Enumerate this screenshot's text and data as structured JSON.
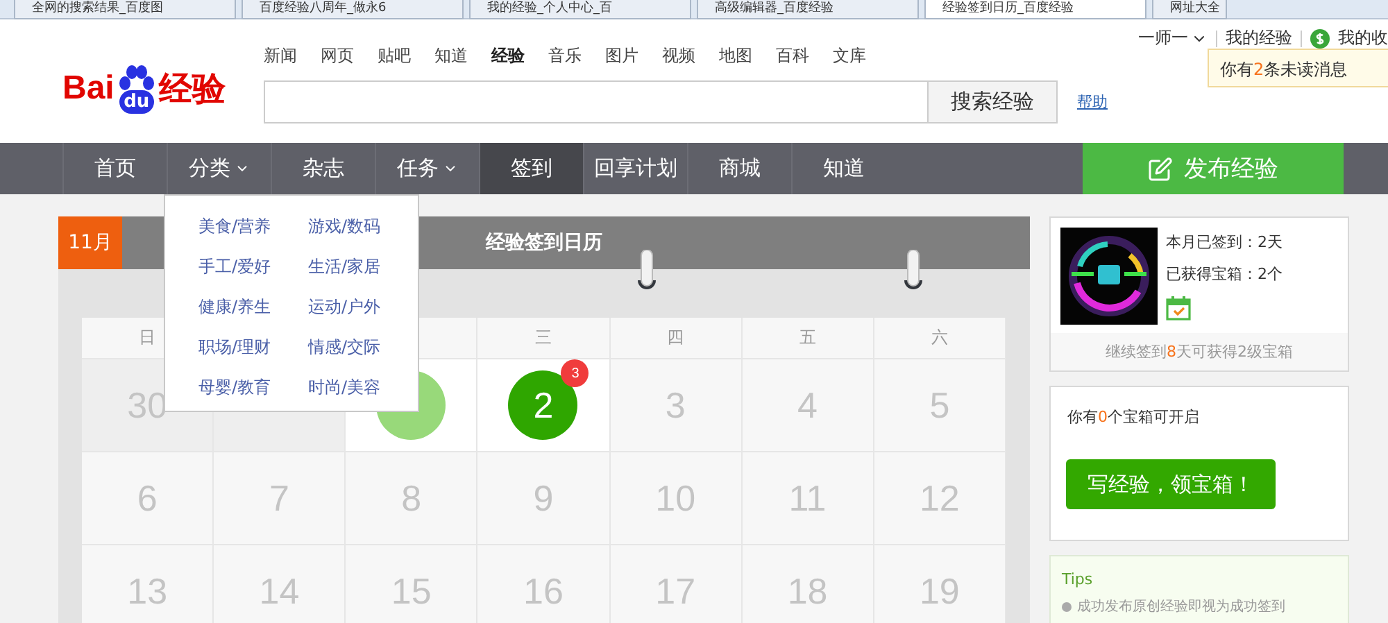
{
  "browser_tabs": [
    {
      "title": "全网的搜索结果_百度图",
      "selected": false
    },
    {
      "title": "百度经验八周年_做永6",
      "selected": false
    },
    {
      "title": "我的经验_个人中心_百",
      "selected": false
    },
    {
      "title": "高级编辑器_百度经验",
      "selected": false
    },
    {
      "title": "经验签到日历_百度经验",
      "selected": true
    },
    {
      "title": "网址大全",
      "selected": false
    }
  ],
  "logo": {
    "left": "Bai",
    "paw": "du",
    "right": "经验"
  },
  "top_links": [
    {
      "label": "新闻",
      "selected": false
    },
    {
      "label": "网页",
      "selected": false
    },
    {
      "label": "贴吧",
      "selected": false
    },
    {
      "label": "知道",
      "selected": false
    },
    {
      "label": "经验",
      "selected": true
    },
    {
      "label": "音乐",
      "selected": false
    },
    {
      "label": "图片",
      "selected": false
    },
    {
      "label": "视频",
      "selected": false
    },
    {
      "label": "地图",
      "selected": false
    },
    {
      "label": "百科",
      "selected": false
    },
    {
      "label": "文库",
      "selected": false
    }
  ],
  "search": {
    "button": "搜索经验",
    "help": "帮助"
  },
  "user_bar": {
    "username": "一师一",
    "my_experience": "我的经验",
    "wallet": "我的收"
  },
  "notice": {
    "before": "你有",
    "count": "2",
    "after": "条未读消息"
  },
  "nav": [
    {
      "label": "首页",
      "selected": false,
      "dropdown": false
    },
    {
      "label": "分类",
      "selected": false,
      "dropdown": true
    },
    {
      "label": "杂志",
      "selected": false,
      "dropdown": false
    },
    {
      "label": "任务",
      "selected": false,
      "dropdown": true
    },
    {
      "label": "签到",
      "selected": true,
      "dropdown": false
    },
    {
      "label": "回享计划",
      "selected": false,
      "dropdown": false
    },
    {
      "label": "商城",
      "selected": false,
      "dropdown": false
    },
    {
      "label": "知道",
      "selected": false,
      "dropdown": false
    }
  ],
  "publish_button": "发布经验",
  "category_menu": [
    "美食/营养",
    "游戏/数码",
    "手工/爱好",
    "生活/家居",
    "健康/养生",
    "运动/户外",
    "职场/理财",
    "情感/交际",
    "母婴/教育",
    "时尚/美容"
  ],
  "calendar": {
    "month": "11月",
    "title": "经验签到日历",
    "weekdays": [
      "日",
      "三",
      "四",
      "五",
      "六"
    ],
    "days": [
      {
        "day": "30",
        "kind": "other"
      },
      {
        "kind": "other"
      },
      {
        "kind": "signed"
      },
      {
        "day": "2",
        "kind": "today",
        "badge": "3"
      },
      {
        "day": "3",
        "kind": "normal"
      },
      {
        "day": "4",
        "kind": "normal"
      },
      {
        "day": "5",
        "kind": "normal"
      },
      {
        "day": "6",
        "kind": "normal"
      },
      {
        "day": "7",
        "kind": "normal"
      },
      {
        "day": "8",
        "kind": "normal"
      },
      {
        "day": "9",
        "kind": "normal"
      },
      {
        "day": "10",
        "kind": "normal"
      },
      {
        "day": "11",
        "kind": "normal"
      },
      {
        "day": "12",
        "kind": "normal"
      },
      {
        "day": "13",
        "kind": "normal"
      },
      {
        "day": "14",
        "kind": "normal"
      },
      {
        "day": "15",
        "kind": "normal"
      },
      {
        "day": "16",
        "kind": "normal"
      },
      {
        "day": "17",
        "kind": "normal"
      },
      {
        "day": "18",
        "kind": "normal"
      },
      {
        "day": "19",
        "kind": "normal"
      }
    ]
  },
  "profile": {
    "signed_this_month": "本月已签到：2天",
    "boxes_earned": "已获得宝箱：2个",
    "progress": {
      "before": "继续签到",
      "count": "8",
      "after": "天可获得2级宝箱"
    }
  },
  "treasure": {
    "message": {
      "before": "你有",
      "count": "0",
      "after": "个宝箱可开启"
    },
    "button": "写经验，领宝箱！"
  },
  "tips": {
    "title": "Tips",
    "items": [
      "成功发布原创经验即视为成功签到"
    ]
  }
}
